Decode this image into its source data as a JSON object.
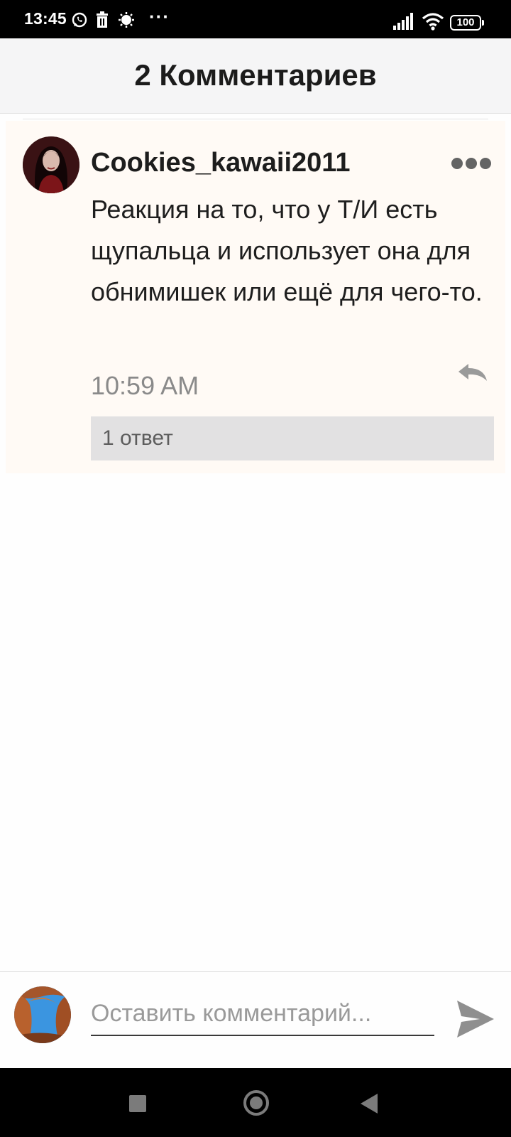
{
  "status_bar": {
    "time": "13:45",
    "battery": "100",
    "overflow": "···"
  },
  "header": {
    "title": "2 Комментариев"
  },
  "comment": {
    "username": "Cookies_kawaii2011",
    "text": "Реакция на то, что у Т/И есть щупальца и использует она для обнимишек или ещё для чего-то.",
    "time": "10:59 AM",
    "replies_label": "1 ответ"
  },
  "input": {
    "placeholder": "Оставить комментарий..."
  },
  "icons": {
    "status": [
      "whatsapp-icon",
      "trash-icon",
      "sun-icon",
      "signal-icon",
      "wifi-icon",
      "battery-icon"
    ],
    "comment": [
      "more-icon",
      "reply-icon"
    ],
    "input": [
      "send-icon"
    ],
    "nav": [
      "recent-apps-icon",
      "home-icon",
      "back-icon"
    ]
  },
  "colors": {
    "card_background": "#fffaf5",
    "header_background": "#f5f5f6",
    "replies_background": "#e2e1e2",
    "timestamp": "#8a8a8a"
  }
}
